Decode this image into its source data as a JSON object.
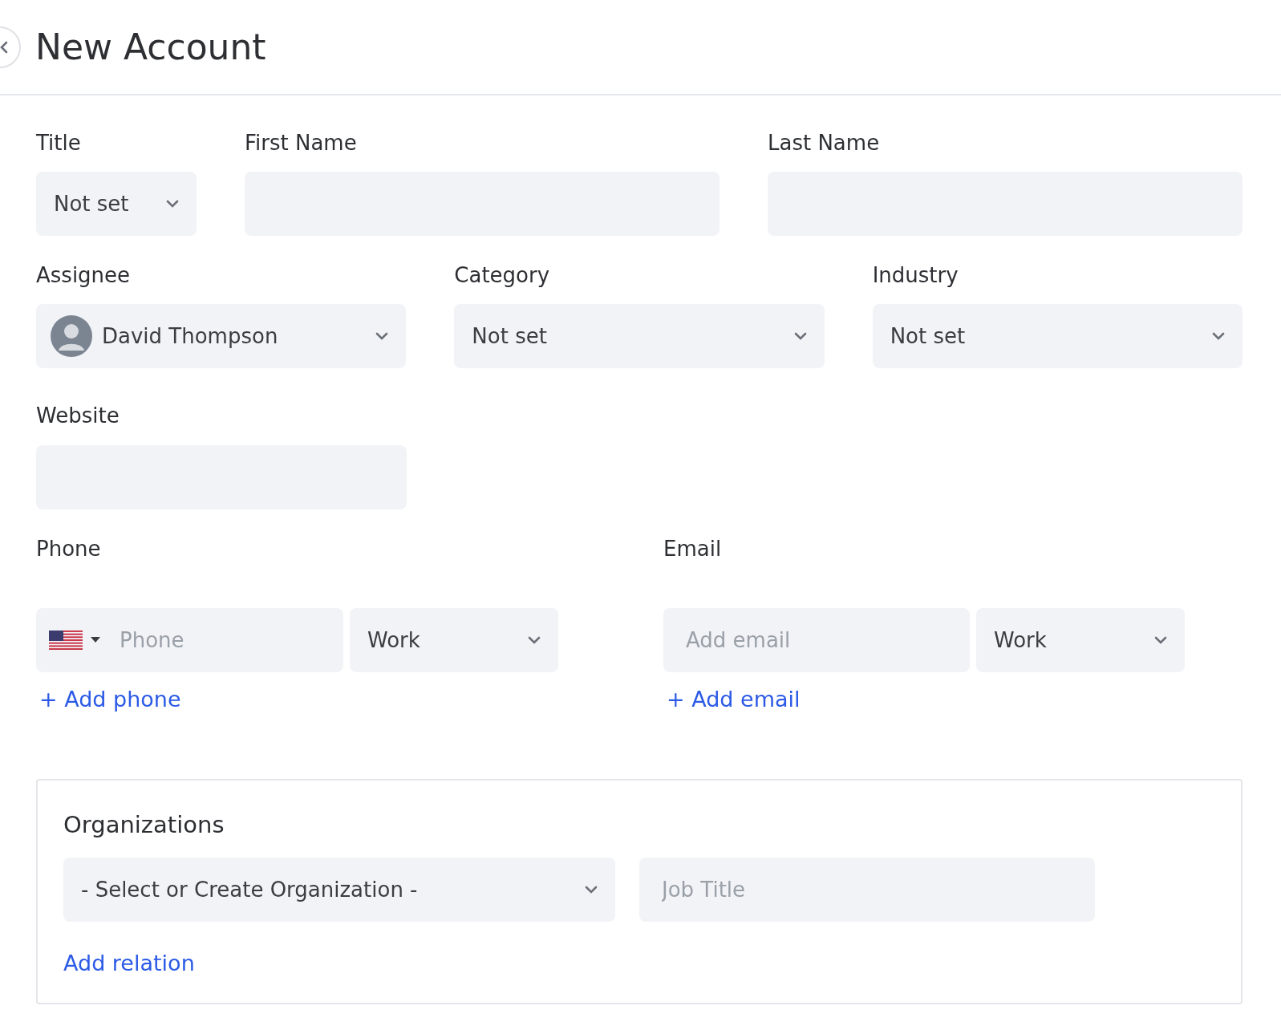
{
  "header": {
    "title": "New Account"
  },
  "name_row": [
    {
      "label": "Title",
      "kind": "select",
      "value": "Not set"
    },
    {
      "label": "First Name",
      "kind": "input"
    },
    {
      "label": "Last Name",
      "kind": "input"
    }
  ],
  "details_row": [
    {
      "label": "Assignee",
      "kind": "person",
      "value": "David Thompson"
    },
    {
      "label": "Category",
      "kind": "select",
      "value": "Not set"
    },
    {
      "label": "Industry",
      "kind": "select",
      "value": "Not set"
    }
  ],
  "website": {
    "label": "Website"
  },
  "phone": {
    "label": "Phone",
    "placeholder": "Phone",
    "type": "Work",
    "add_link": "+ Add phone"
  },
  "email": {
    "label": "Email",
    "placeholder": "Add email",
    "type": "Work",
    "add_link": "+ Add email"
  },
  "organizations": {
    "title": "Organizations",
    "select": "- Select or Create Organization -",
    "job_title_placeholder": "Job Title",
    "add_link": "Add relation"
  }
}
